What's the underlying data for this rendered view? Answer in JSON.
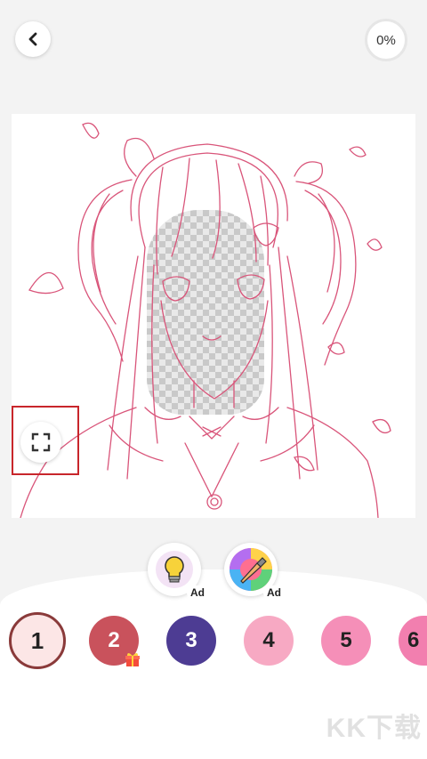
{
  "header": {
    "back_icon": "chevron-left-icon",
    "progress_text": "0%"
  },
  "canvas": {
    "description_icon": "line-art-girl",
    "fullscreen_icon": "expand-corners-icon"
  },
  "tools": {
    "hint": {
      "icon": "lightbulb-icon",
      "badge": "Ad"
    },
    "magic": {
      "icon": "rainbow-brush-icon",
      "badge": "Ad"
    }
  },
  "palette": [
    {
      "label": "1",
      "color": "#fce6e6",
      "text_color": "#222222",
      "selected": true
    },
    {
      "label": "2",
      "color": "#c9525c",
      "text_color": "#ffffff",
      "selected": false,
      "gift": true
    },
    {
      "label": "3",
      "color": "#4d3c93",
      "text_color": "#ffffff",
      "selected": false
    },
    {
      "label": "4",
      "color": "#f7a9c3",
      "text_color": "#222222",
      "selected": false
    },
    {
      "label": "5",
      "color": "#f58fb8",
      "text_color": "#222222",
      "selected": false
    },
    {
      "label": "6",
      "color": "#f27faf",
      "text_color": "#222222",
      "selected": false
    }
  ],
  "watermark": "KK下载",
  "colors": {
    "lineart": "#d9557a",
    "highlight_box": "#c8262b"
  }
}
